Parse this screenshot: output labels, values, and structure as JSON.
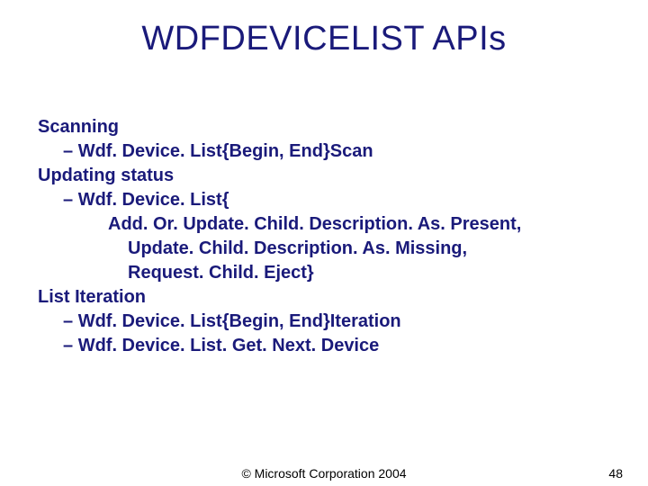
{
  "title": "WDFDEVICELIST APIs",
  "body": {
    "h1": "Scanning",
    "l1a": "Wdf. Device. List{Begin, End}Scan",
    "h2": "Updating status",
    "l2a": "Wdf. Device. List{",
    "l2b": "Add. Or. Update. Child. Description. As. Present,",
    "l2c": "Update. Child. Description. As. Missing,",
    "l2d": "Request. Child. Eject}",
    "h3": "List Iteration",
    "l3a": "Wdf. Device. List{Begin, End}Iteration",
    "l3b": "Wdf. Device. List. Get. Next. Device"
  },
  "footer": {
    "copyright": "© Microsoft Corporation 2004",
    "page": "48"
  }
}
